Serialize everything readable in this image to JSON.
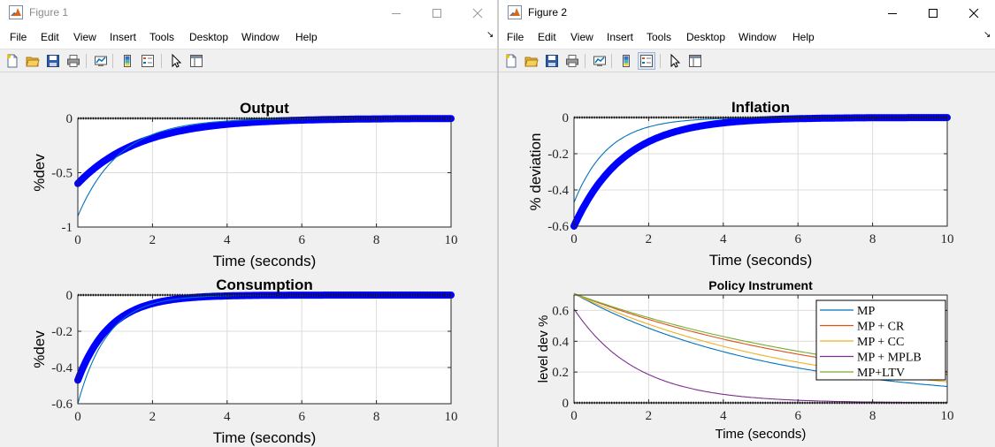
{
  "windows": [
    {
      "title": "Figure 1",
      "active": false,
      "menu": [
        "File",
        "Edit",
        "View",
        "Insert",
        "Tools",
        "Desktop",
        "Window",
        "Help"
      ],
      "controls": {
        "minimize": "minimize-icon",
        "maximize": "maximize-icon",
        "close": "close-icon"
      }
    },
    {
      "title": "Figure 2",
      "active": true,
      "menu": [
        "File",
        "Edit",
        "View",
        "Insert",
        "Tools",
        "Desktop",
        "Window",
        "Help"
      ],
      "controls": {
        "minimize": "minimize-icon",
        "maximize": "maximize-icon",
        "close": "close-icon"
      }
    }
  ],
  "toolbar_icons": [
    "new-figure-icon",
    "open-file-icon",
    "save-icon",
    "print-icon",
    "link-plot-icon",
    "colorbar-icon",
    "legend-icon",
    "edit-plot-icon",
    "property-inspector-icon"
  ],
  "colors": {
    "thick": "#0000ff",
    "thin": "#0072bd",
    "zero": "#000000",
    "grid": "#dcdcdc",
    "axes": "#262626",
    "window_bg": "#f0f0f0"
  },
  "chart_data": [
    {
      "id": "output",
      "window": 0,
      "type": "line",
      "title": "Output",
      "xlabel": "Time (seconds)",
      "ylabel": "%dev",
      "xlim": [
        0,
        10
      ],
      "ylim": [
        -1,
        0
      ],
      "xticks": [
        0,
        2,
        4,
        6,
        8,
        10
      ],
      "yticks": [
        -1,
        -0.5,
        0
      ],
      "ytick_labels": [
        "-1",
        "-0.5",
        "0"
      ],
      "grid": true,
      "series": [
        {
          "style": "thick",
          "start": -0.6,
          "rate": 0.6
        },
        {
          "style": "thin",
          "start": -0.9,
          "rate": 0.9
        },
        {
          "style": "zero",
          "start": 0,
          "rate": 0
        }
      ]
    },
    {
      "id": "consumption",
      "window": 0,
      "type": "line",
      "title": "Consumption",
      "xlabel": "Time (seconds)",
      "ylabel": "%dev",
      "xlim": [
        0,
        10
      ],
      "ylim": [
        -0.6,
        0
      ],
      "xticks": [
        0,
        2,
        4,
        6,
        8,
        10
      ],
      "yticks": [
        -0.6,
        -0.4,
        -0.2,
        0
      ],
      "ytick_labels": [
        "-0.6",
        "-0.4",
        "-0.2",
        "0"
      ],
      "grid": true,
      "series": [
        {
          "style": "thick",
          "start": -0.47,
          "rate": 1.15
        },
        {
          "style": "thin",
          "start": -0.6,
          "rate": 1.25
        },
        {
          "style": "zero",
          "start": 0,
          "rate": 0
        }
      ]
    },
    {
      "id": "inflation",
      "window": 1,
      "type": "line",
      "title": "Inflation",
      "xlabel": "Time (seconds)",
      "ylabel": "% deviation",
      "xlim": [
        0,
        10
      ],
      "ylim": [
        -0.6,
        0
      ],
      "xticks": [
        0,
        2,
        4,
        6,
        8,
        10
      ],
      "yticks": [
        -0.6,
        -0.4,
        -0.2,
        0
      ],
      "ytick_labels": [
        "-0.6",
        "-0.4",
        "-0.2",
        "0"
      ],
      "grid": true,
      "series": [
        {
          "style": "thick",
          "start": -0.6,
          "rate": 0.75
        },
        {
          "style": "thin",
          "start": -0.47,
          "rate": 1.1
        },
        {
          "style": "zero",
          "start": 0,
          "rate": 0
        }
      ]
    },
    {
      "id": "policy",
      "window": 1,
      "type": "line",
      "title": "Policy Instrument",
      "xlabel": "Time (seconds)",
      "ylabel": "level dev %",
      "xlim": [
        0,
        10
      ],
      "ylim": [
        0,
        0.7
      ],
      "xticks": [
        0,
        2,
        4,
        6,
        8,
        10
      ],
      "yticks": [
        0,
        0.2,
        0.4,
        0.6
      ],
      "ytick_labels": [
        "0",
        "0.2",
        "0.4",
        "0.6"
      ],
      "grid": true,
      "legend": "top-right",
      "series": [
        {
          "name": "MP",
          "color": "#0072bd",
          "start": 0.71,
          "rate": 0.19
        },
        {
          "name": "MP + CR",
          "color": "#d95319",
          "start": 0.71,
          "rate": 0.135
        },
        {
          "name": "MP + CC",
          "color": "#edb120",
          "start": 0.71,
          "rate": 0.165
        },
        {
          "name": "MP + MPLB",
          "color": "#7e2f8e",
          "start": 0.61,
          "rate": 0.6
        },
        {
          "name": "MP+LTV",
          "color": "#77ac30",
          "start": 0.71,
          "rate": 0.125
        },
        {
          "style": "zero",
          "start": 0,
          "rate": 0
        }
      ]
    }
  ]
}
